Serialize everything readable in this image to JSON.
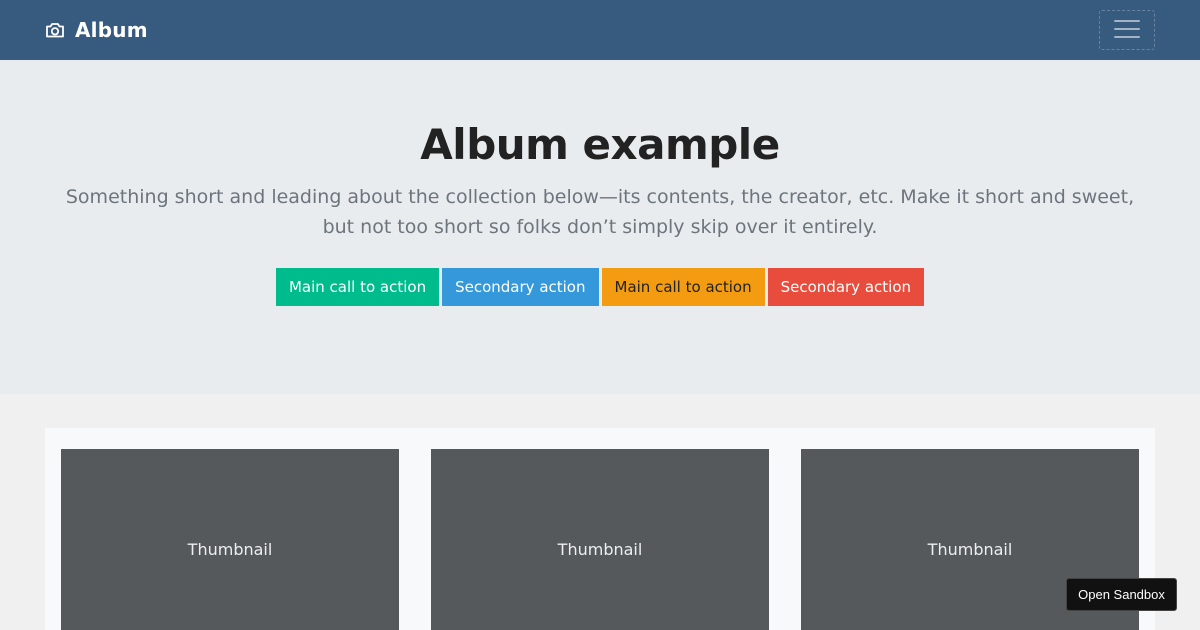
{
  "navbar": {
    "brand": "Album",
    "brand_icon": "camera-icon",
    "toggler_icon": "hamburger-icon"
  },
  "hero": {
    "title": "Album example",
    "lead": "Something short and leading about the collection below—its contents, the creator, etc. Make it short and sweet, but not too short so folks don’t simply skip over it entirely.",
    "buttons": [
      {
        "label": "Main call to action",
        "color": "#00bc8c"
      },
      {
        "label": "Secondary action",
        "color": "#3498db"
      },
      {
        "label": "Main call to action",
        "color": "#f39c12"
      },
      {
        "label": "Secondary action",
        "color": "#e74c3c"
      }
    ]
  },
  "album": {
    "cards": [
      {
        "label": "Thumbnail"
      },
      {
        "label": "Thumbnail"
      },
      {
        "label": "Thumbnail"
      }
    ]
  },
  "sandbox": {
    "label": "Open Sandbox"
  },
  "colors": {
    "navbar_bg": "#375a7f",
    "hero_bg": "#e9ecef",
    "thumbnail_bg": "#55595c"
  }
}
